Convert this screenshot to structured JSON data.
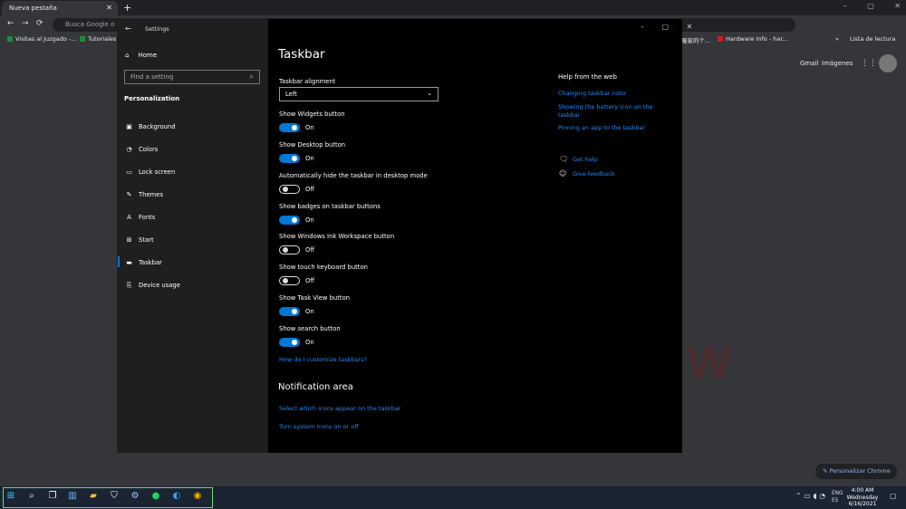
{
  "chrome": {
    "tab_title": "Nueva pestaña",
    "omnibox_placeholder": "Busca Google o e",
    "bookmarks": [
      "Visitas al Juzgado -...",
      "Tutoriales y",
      "喔家的个...",
      "Hardware Info - har...",
      "»",
      "Lista de lectura"
    ],
    "gmail": "Gmail",
    "images": "Imágenes",
    "personalize": "Personalizar Chrome"
  },
  "settings": {
    "window_title": "Settings",
    "home": "Home",
    "search_placeholder": "Find a setting",
    "section": "Personalization",
    "nav_items": [
      {
        "label": "Background",
        "icon": "image-icon"
      },
      {
        "label": "Colors",
        "icon": "palette-icon"
      },
      {
        "label": "Lock screen",
        "icon": "monitor-icon"
      },
      {
        "label": "Themes",
        "icon": "brush-icon"
      },
      {
        "label": "Fonts",
        "icon": "font-icon"
      },
      {
        "label": "Start",
        "icon": "start-icon"
      },
      {
        "label": "Taskbar",
        "icon": "taskbar-icon",
        "active": true
      },
      {
        "label": "Device usage",
        "icon": "device-icon"
      }
    ],
    "page_title": "Taskbar",
    "alignment_label": "Taskbar alignment",
    "alignment_value": "Left",
    "toggles": [
      {
        "label": "Show Widgets button",
        "state": "On",
        "on": true
      },
      {
        "label": "Show Desktop button",
        "state": "On",
        "on": true
      },
      {
        "label": "Automatically hide the taskbar in desktop mode",
        "state": "Off",
        "on": false
      },
      {
        "label": "Show badges on taskbar buttons",
        "state": "On",
        "on": true
      },
      {
        "label": "Show Windows Ink Workspace button",
        "state": "Off",
        "on": false
      },
      {
        "label": "Show touch keyboard button",
        "state": "Off",
        "on": false
      },
      {
        "label": "Show Task View button",
        "state": "On",
        "on": true
      },
      {
        "label": "Show search button",
        "state": "On",
        "on": true
      }
    ],
    "customize_link": "How do I customize taskbars?",
    "notification_area": "Notification area",
    "notif_links": [
      "Select which icons appear on the taskbar",
      "Turn system icons on or off"
    ],
    "help_title": "Help from the web",
    "help_links": [
      "Changing taskbar color",
      "Showing the battery icon on the taskbar",
      "Pinning an app to the taskbar"
    ],
    "get_help": "Get help",
    "give_feedback": "Give feedback"
  },
  "taskbar": {
    "lang_1": "ENG",
    "lang_2": "ES",
    "time": "4:00 AM",
    "day": "Wednesday",
    "date": "6/16/2021"
  },
  "watermark": "PROFESIONAL review"
}
